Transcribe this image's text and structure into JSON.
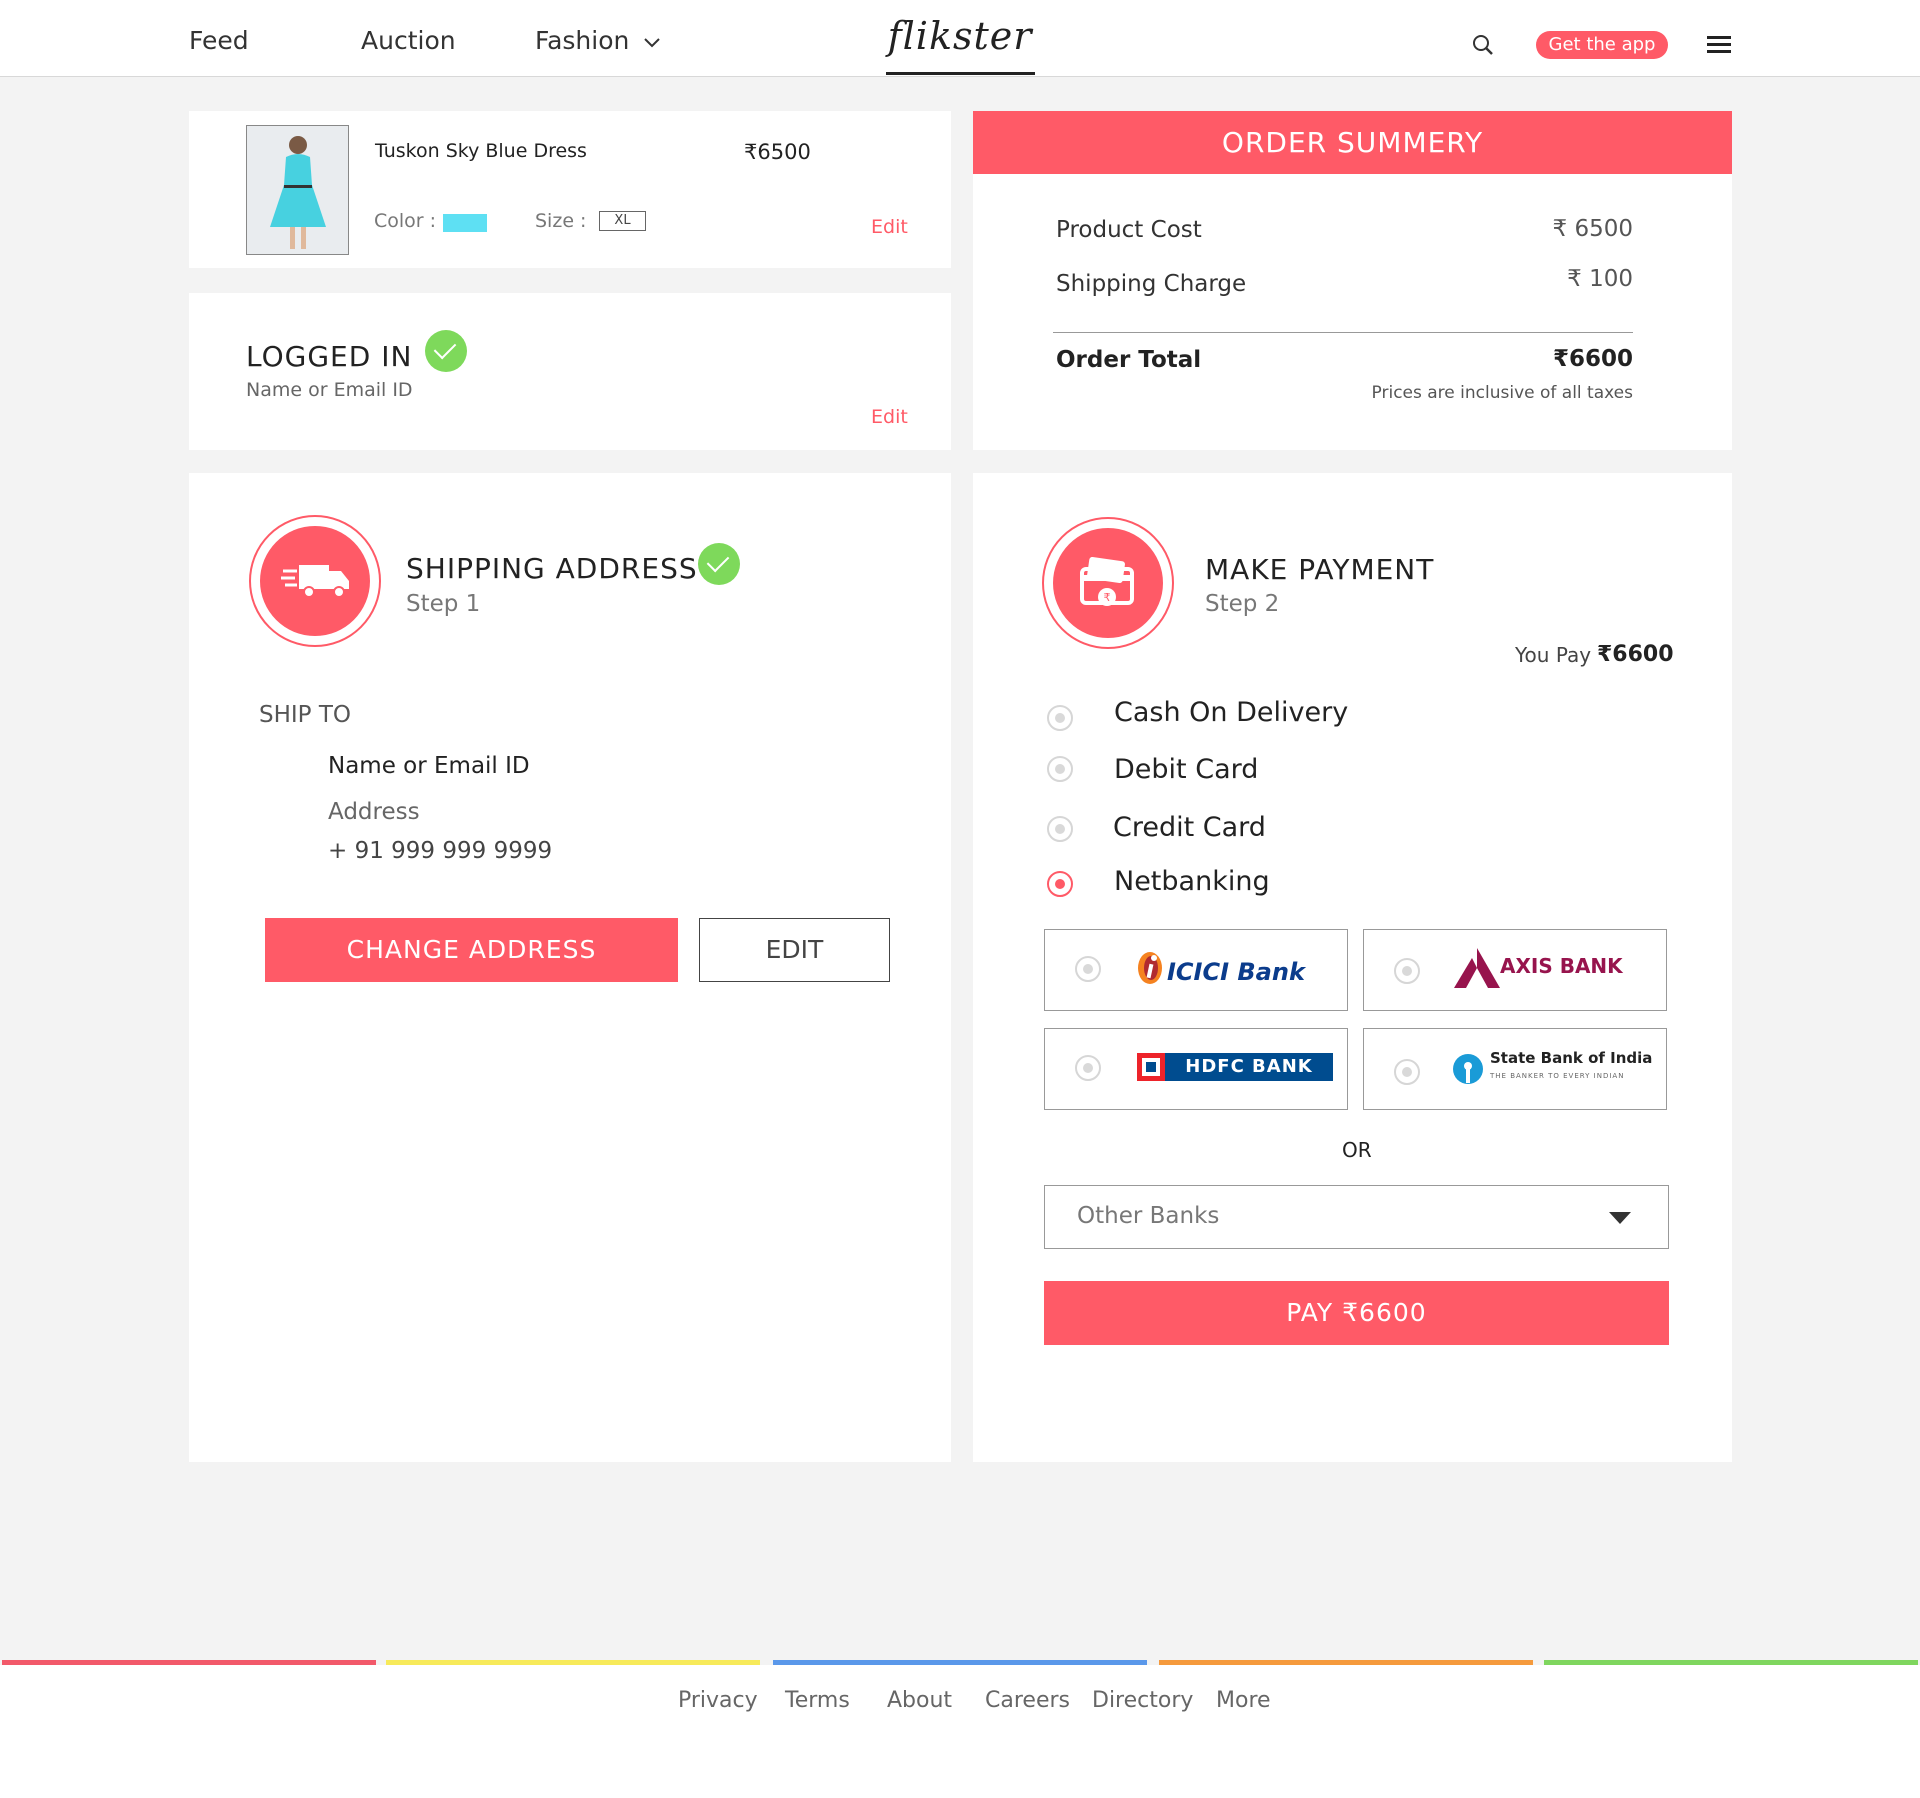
{
  "header": {
    "nav": [
      "Feed",
      "Auction",
      "Fashion"
    ],
    "logo": "flikster",
    "get_app": "Get the app"
  },
  "product": {
    "name": "Tuskon Sky Blue Dress",
    "price": "₹6500",
    "color_label": "Color :",
    "color_value": "#5ee0f3",
    "size_label": "Size :",
    "size_value": "XL",
    "edit": "Edit"
  },
  "login": {
    "title": "LOGGED IN",
    "subtitle": "Name or Email ID",
    "edit": "Edit"
  },
  "summary": {
    "title": "ORDER SUMMERY",
    "product_cost_label": "Product Cost",
    "product_cost_value": "₹ 6500",
    "shipping_label": "Shipping Charge",
    "shipping_value": "₹ 100",
    "total_label": "Order Total",
    "total_value": "₹6600",
    "tax_note": "Prices are inclusive of all taxes"
  },
  "shipping": {
    "title": "SHIPPING ADDRESS",
    "step": "Step 1",
    "ship_to": "SHIP TO",
    "name": "Name or Email ID",
    "address": "Address",
    "phone": "+ 91 999 999 9999",
    "change_btn": "CHANGE ADDRESS",
    "edit_btn": "EDIT"
  },
  "payment": {
    "title": "MAKE PAYMENT",
    "step": "Step 2",
    "you_pay_label": "You Pay",
    "you_pay_value": "₹6600",
    "options": [
      "Cash On Delivery",
      "Debit Card",
      "Credit Card",
      "Netbanking"
    ],
    "selected": "Netbanking",
    "banks": [
      "ICICI Bank",
      "AXIS BANK",
      "HDFC BANK",
      "State Bank of India"
    ],
    "sbi_tagline": "THE BANKER TO EVERY INDIAN",
    "or": "OR",
    "other_banks": "Other Banks",
    "pay_btn": "PAY ₹6600"
  },
  "footer": {
    "links": [
      "Privacy",
      "Terms",
      "About",
      "Careers",
      "Directory",
      "More"
    ],
    "bar_colors": [
      "#f2596a",
      "#f7ea5a",
      "#5a98ea",
      "#f59a3c",
      "#7fd65e"
    ]
  },
  "colors": {
    "accent": "#ff5a67",
    "success": "#7ed95b"
  }
}
